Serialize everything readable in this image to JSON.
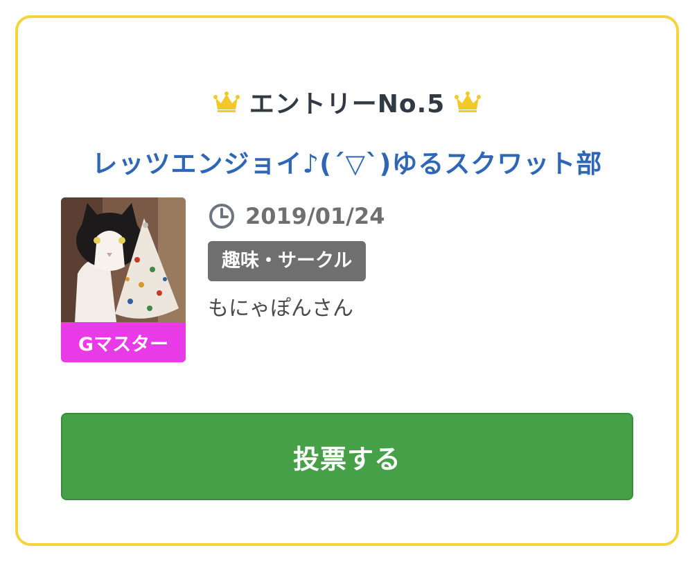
{
  "entry": {
    "label": "エントリーNo.5",
    "icons": {
      "left": "crown-icon",
      "right": "crown-icon"
    },
    "crown_color": "#f3c928"
  },
  "group": {
    "title": "レッツエンジョイ♪(´▽`)ゆるスクワット部"
  },
  "avatar": {
    "image": "cat-photo",
    "badge": "Gマスター",
    "badge_color": "#e83ae6"
  },
  "meta": {
    "date_icon": "clock-icon",
    "date": "2019/01/24",
    "category": "趣味・サークル",
    "author": "もにゃぽんさん"
  },
  "vote": {
    "label": "投票する",
    "color": "#46a047"
  },
  "card": {
    "border_color": "#f3d43a"
  }
}
